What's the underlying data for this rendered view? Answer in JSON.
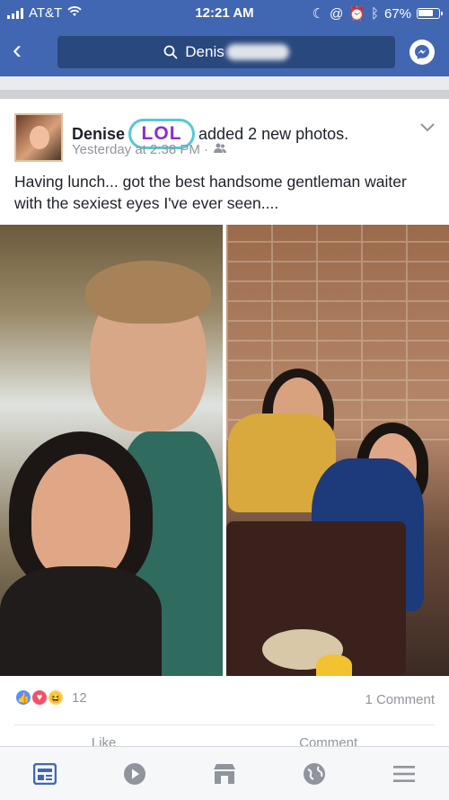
{
  "status_bar": {
    "carrier": "AT&T",
    "time": "12:21 AM",
    "battery": "67%"
  },
  "nav": {
    "search_text": "Denis"
  },
  "post": {
    "author": "Denise",
    "sticker": "LOL",
    "action": "added 2 new photos.",
    "timestamp": "Yesterday at 2:38 PM ·",
    "text": "Having lunch... got the best handsome gentleman waiter with the sexiest eyes I've ever seen....",
    "reaction_count": "12",
    "comments": "1 Comment",
    "actions": [
      "Like",
      "Comment"
    ]
  },
  "tabs": [
    "news-feed-icon",
    "watch-icon",
    "marketplace-icon",
    "globe-icon",
    "menu-icon"
  ],
  "colors": {
    "brand": "#4267b2",
    "tab_active": "#4267b2",
    "tab_inactive": "#90949c"
  }
}
